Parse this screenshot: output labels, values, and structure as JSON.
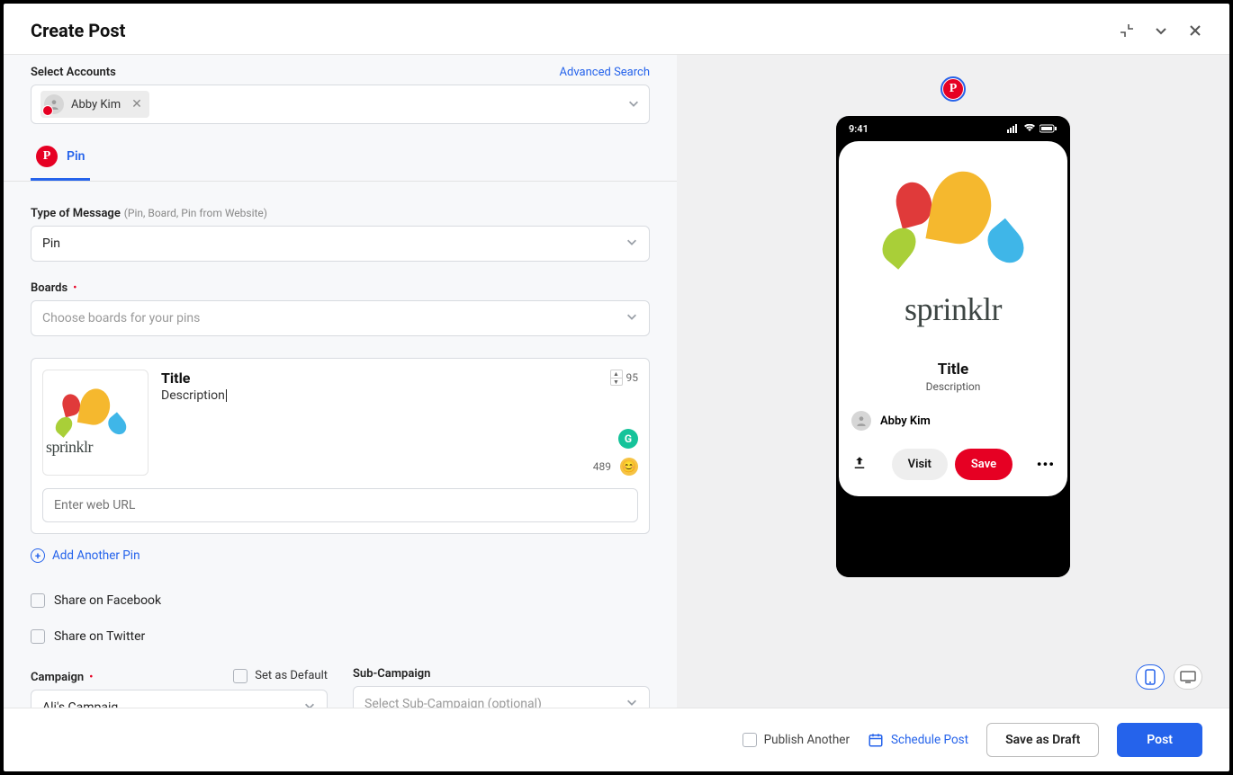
{
  "header": {
    "title": "Create Post"
  },
  "accounts": {
    "label": "Select Accounts",
    "advanced_search": "Advanced Search",
    "selected": {
      "name": "Abby Kim"
    }
  },
  "tab": {
    "label": "Pin"
  },
  "type_of_message": {
    "label": "Type of Message",
    "hint": "(Pin, Board, Pin from Website)",
    "value": "Pin"
  },
  "boards": {
    "label": "Boards",
    "placeholder": "Choose boards for your pins"
  },
  "pin": {
    "title": "Title",
    "description": "Description",
    "title_remaining": "95",
    "desc_remaining": "489",
    "url_placeholder": "Enter web URL",
    "brand": "sprinklr"
  },
  "add_pin": "Add Another Pin",
  "share_fb": "Share on Facebook",
  "share_tw": "Share on Twitter",
  "campaign": {
    "label": "Campaign",
    "set_default": "Set as Default",
    "value": "Ali's Campaig"
  },
  "sub_campaign": {
    "label": "Sub-Campaign",
    "placeholder": "Select Sub-Campaign (optional)"
  },
  "preview": {
    "time": "9:41",
    "title": "Title",
    "description": "Description",
    "author": "Abby Kim",
    "visit": "Visit",
    "save": "Save"
  },
  "footer": {
    "publish_another": "Publish Another",
    "schedule": "Schedule Post",
    "save_draft": "Save as Draft",
    "post": "Post"
  }
}
